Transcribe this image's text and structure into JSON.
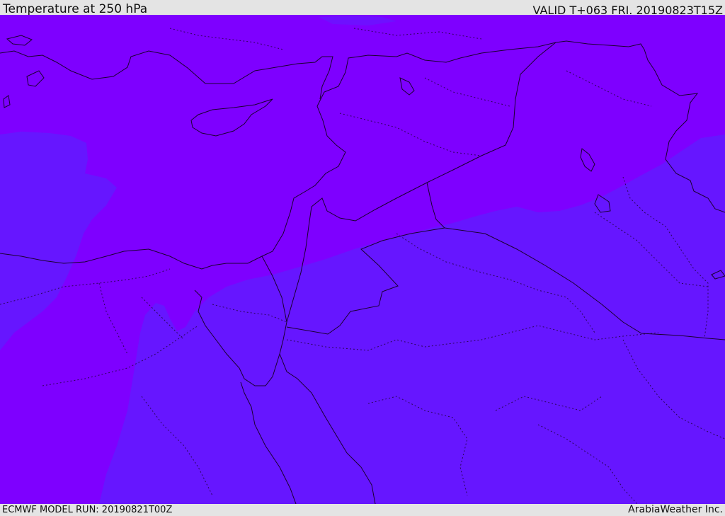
{
  "header": {
    "title": "Temperature at 250 hPa",
    "valid": "VALID T+063 FRI. 20190823T15Z"
  },
  "footer": {
    "model_run": "ECMWF MODEL RUN: 20190821T00Z",
    "credit": "ArabiaWeather Inc."
  },
  "colors": {
    "band_cold": "#7e00ff",
    "band_warm": "#6616ff",
    "borders": "#1a0030",
    "frame": "#e4e4e4"
  }
}
